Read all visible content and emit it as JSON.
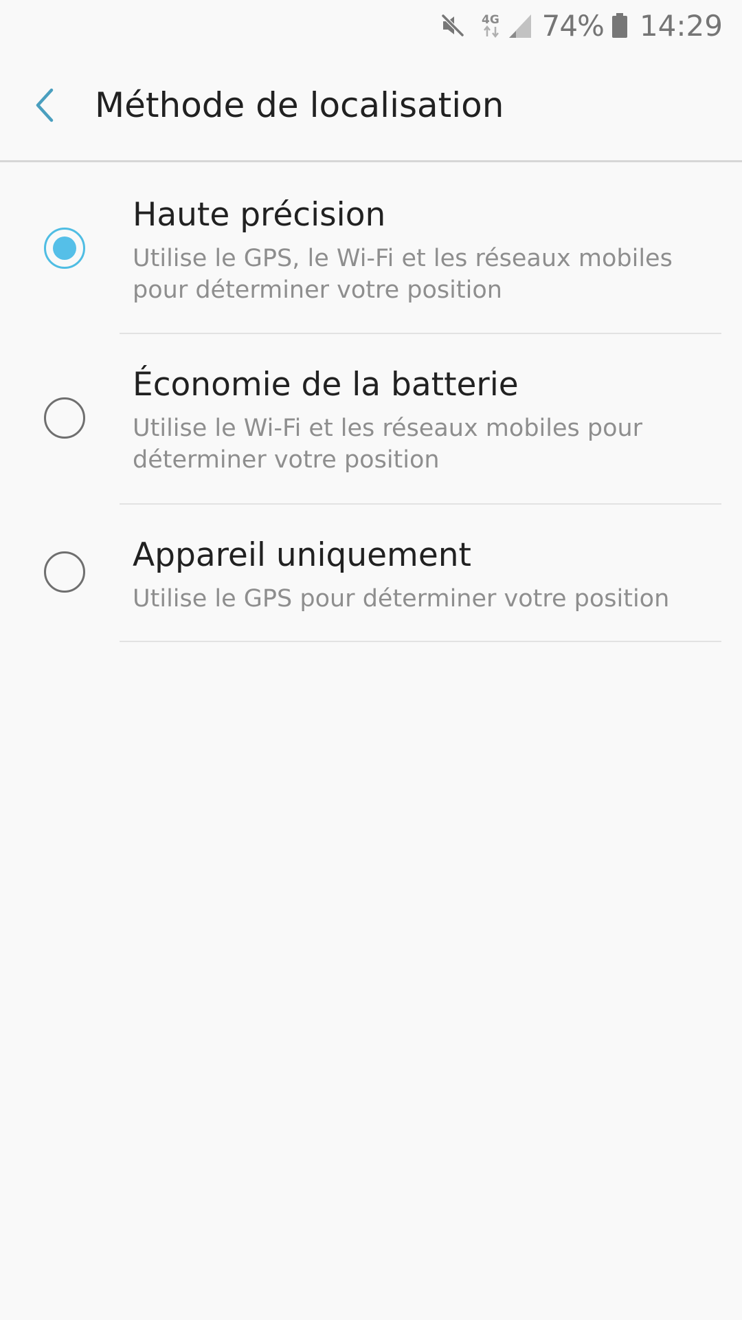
{
  "status_bar": {
    "network": "4G",
    "battery_percent": "74%",
    "time": "14:29",
    "icons": [
      "mute-icon",
      "network-4g-icon",
      "signal-icon",
      "battery-icon"
    ]
  },
  "app_bar": {
    "back_icon": "chevron-left-icon",
    "title": "Méthode de localisation"
  },
  "options": [
    {
      "label": "Haute précision",
      "description": "Utilise le GPS, le Wi-Fi et les réseaux mobiles pour déterminer votre position",
      "selected": true
    },
    {
      "label": "Économie de la batterie",
      "description": "Utilise le Wi-Fi et les réseaux mobiles pour déterminer votre position",
      "selected": false
    },
    {
      "label": "Appareil uniquement",
      "description": "Utilise le GPS pour déterminer votre position",
      "selected": false
    }
  ],
  "colors": {
    "accent": "#55bfe8",
    "back_arrow": "#4a9fbf",
    "title_text": "#212121",
    "secondary_text": "#8e8e8e",
    "background": "#f9f9f9"
  }
}
